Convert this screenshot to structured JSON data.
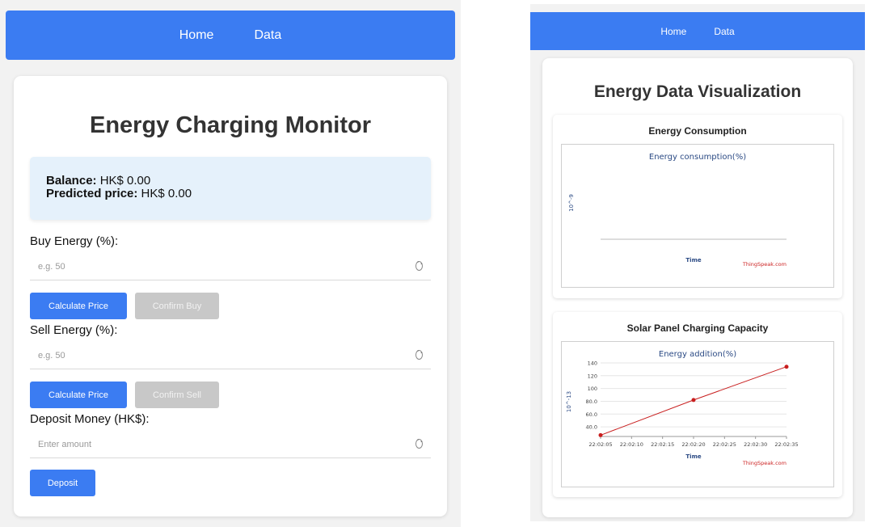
{
  "left": {
    "nav": {
      "home": "Home",
      "data": "Data"
    },
    "title": "Energy Charging Monitor",
    "balance_label": "Balance:",
    "balance_value": "HK$ 0.00",
    "predicted_label": "Predicted price:",
    "predicted_value": "HK$ 0.00",
    "buy": {
      "label": "Buy Energy (%):",
      "placeholder": "e.g. 50",
      "calc_button": "Calculate Price",
      "confirm_button": "Confirm Buy"
    },
    "sell": {
      "label": "Sell Energy (%):",
      "placeholder": "e.g. 50",
      "calc_button": "Calculate Price",
      "confirm_button": "Confirm Sell"
    },
    "deposit": {
      "label": "Deposit Money (HK$):",
      "placeholder": "Enter amount",
      "button": "Deposit"
    }
  },
  "right": {
    "nav": {
      "home": "Home",
      "data": "Data"
    },
    "title": "Energy Data Visualization",
    "charts_titles": [
      "Energy Consumption",
      "Solar Panel Charging Capacity"
    ]
  },
  "chart_data": [
    {
      "type": "line",
      "title": "Energy consumption(%)",
      "panel_title": "Energy Consumption",
      "xlabel": "Time",
      "ylabel": "10^-9",
      "credit": "ThingSpeak.com",
      "series": [
        {
          "values": []
        }
      ]
    },
    {
      "type": "line",
      "title": "Energy addition(%)",
      "panel_title": "Solar Panel Charging Capacity",
      "xlabel": "Time",
      "ylabel": "10^-13",
      "credit": "ThingSpeak.com",
      "x_ticks": [
        "22:02:05",
        "22:02:10",
        "22:02:15",
        "22:02:20",
        "22:02:25",
        "22:02:30",
        "22:02:35"
      ],
      "y_ticks": [
        "40.0",
        "60.0",
        "80.0",
        "100",
        "120",
        "140"
      ],
      "ylim": [
        25,
        145
      ],
      "series": [
        {
          "x": [
            "22:02:05",
            "22:02:20",
            "22:02:35"
          ],
          "values": [
            27,
            82,
            134
          ],
          "color": "#c81e1e"
        }
      ]
    }
  ]
}
